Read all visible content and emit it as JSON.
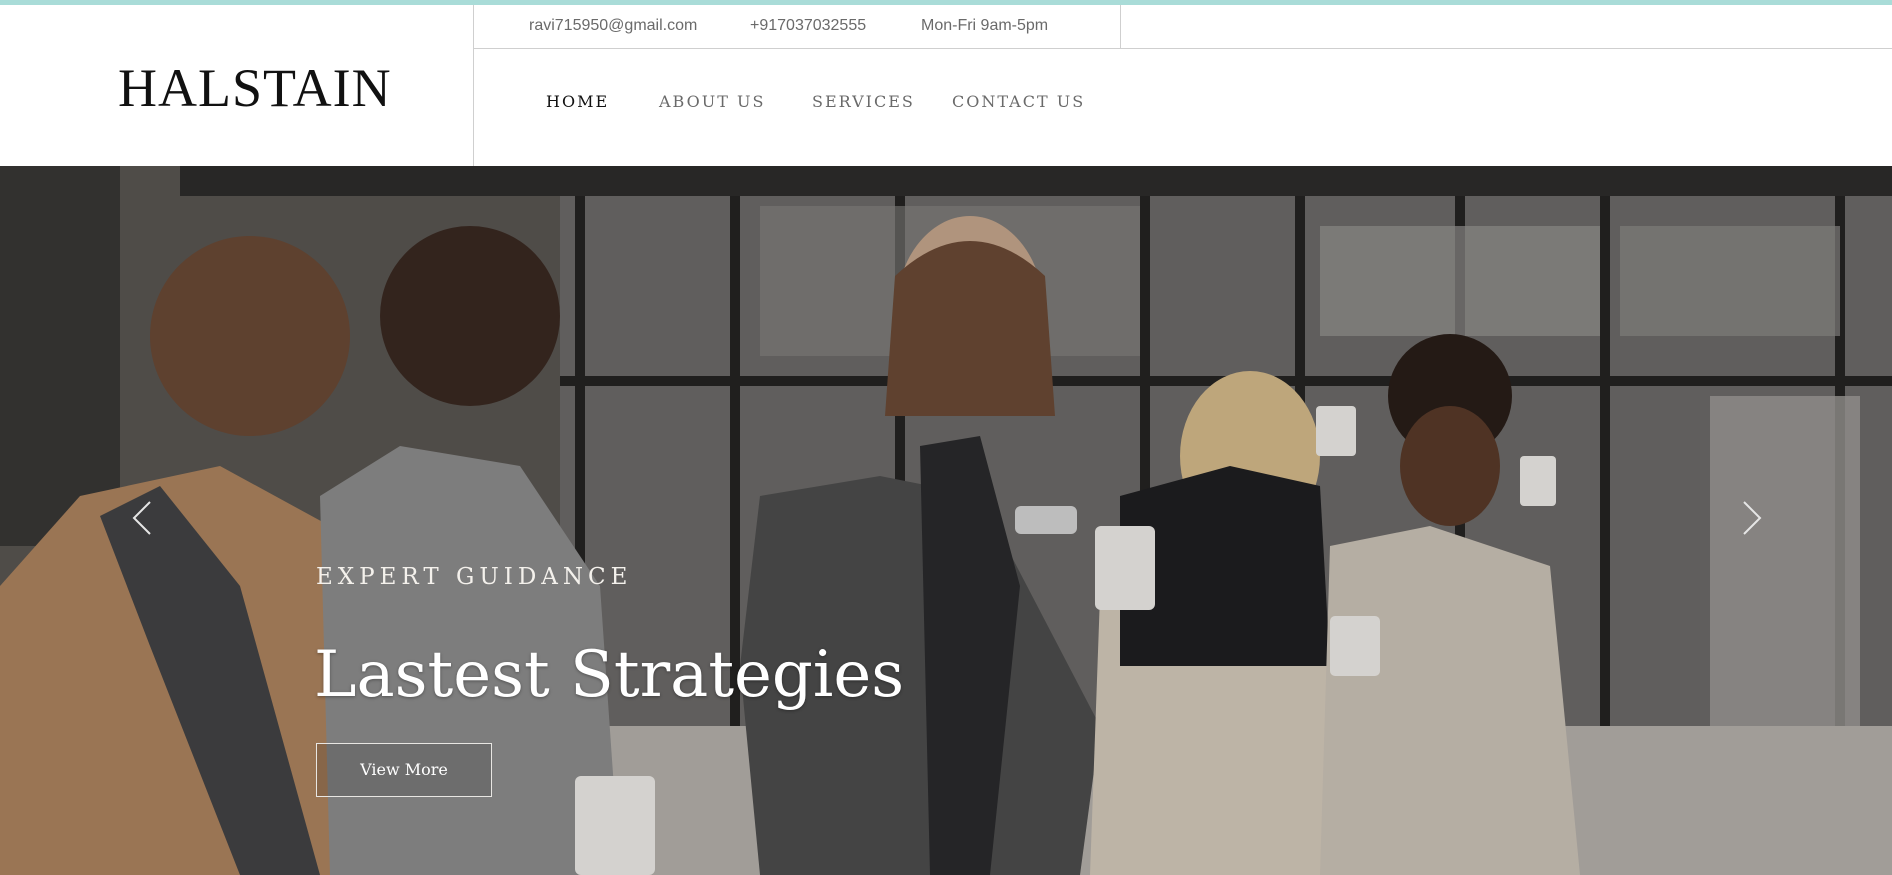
{
  "brand": {
    "logo_text": "HALSTAIN"
  },
  "topbar": {
    "email": "ravi715950@gmail.com",
    "phone": "+917037032555",
    "hours": "Mon-Fri 9am-5pm"
  },
  "nav": {
    "items": [
      {
        "label": "HOME",
        "active": true
      },
      {
        "label": "ABOUT US",
        "active": false
      },
      {
        "label": "SERVICES",
        "active": false
      },
      {
        "label": "CONTACT US",
        "active": false
      }
    ]
  },
  "hero": {
    "eyebrow": "EXPERT GUIDANCE",
    "title": "Lastest Strategies",
    "button_label": "View More",
    "prev_icon": "chevron-left-icon",
    "next_icon": "chevron-right-icon"
  },
  "colors": {
    "accent_bar": "#a9dcd8",
    "text_muted": "#6a6a6a",
    "text_dark": "#111111"
  }
}
